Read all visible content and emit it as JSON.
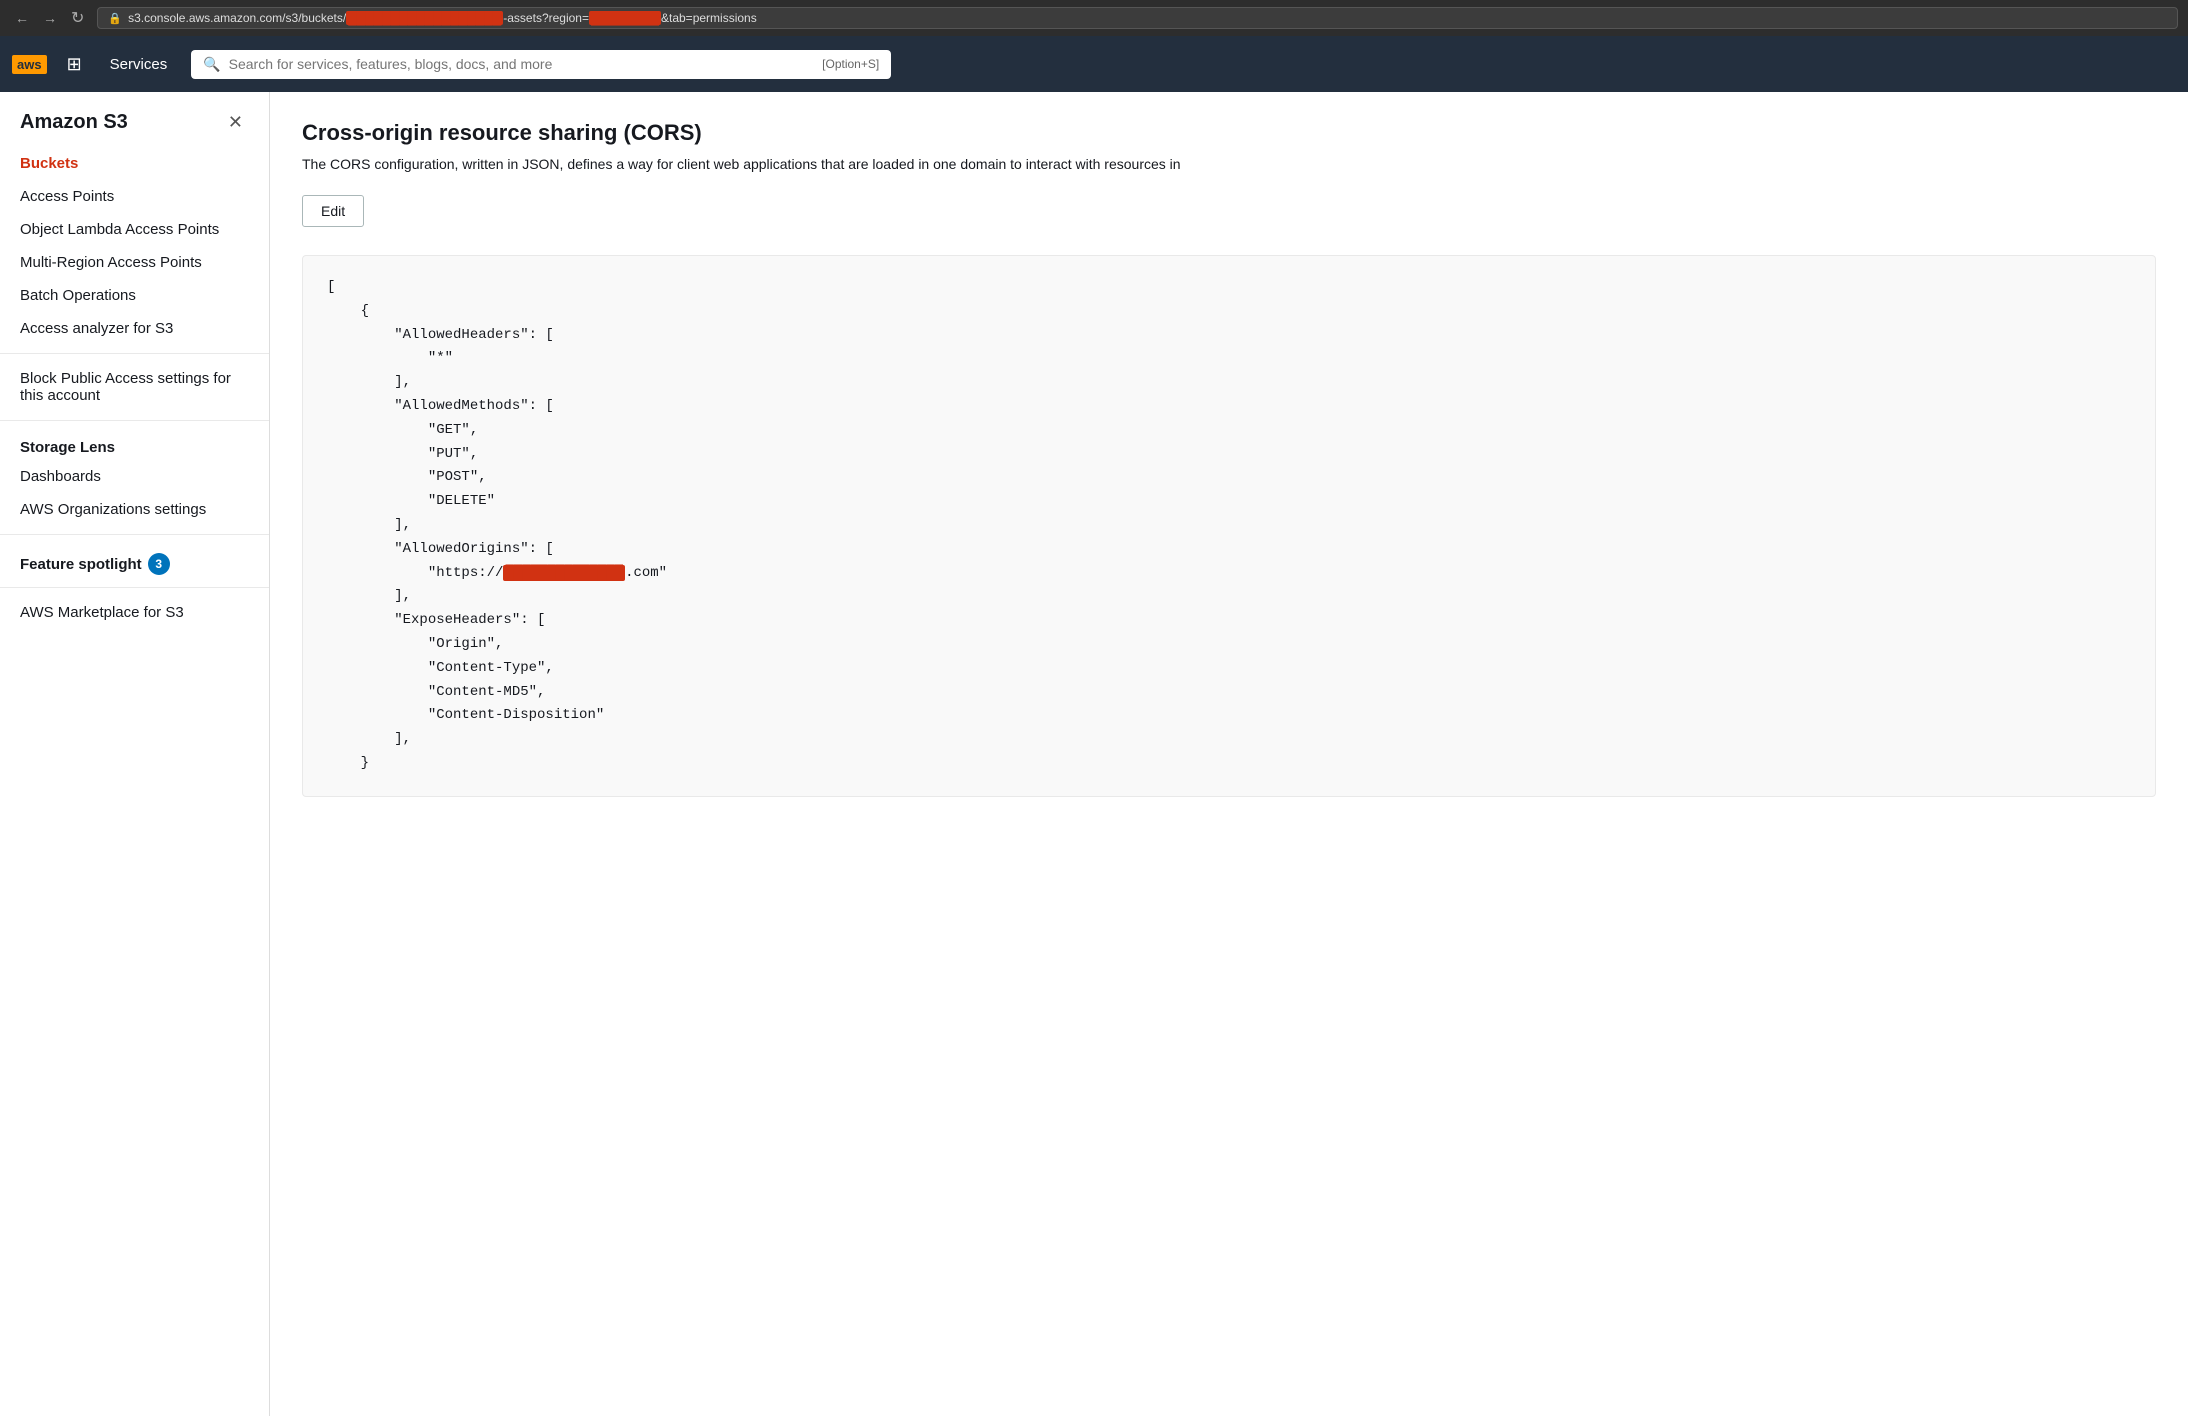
{
  "browser": {
    "address": "s3.console.aws.amazon.com/s3/buckets/",
    "address_suffix": "-assets?region=",
    "address_end": "&tab=permissions",
    "lock_icon": "🔒"
  },
  "aws_nav": {
    "logo_text": "aws",
    "services_label": "Services",
    "search_placeholder": "Search for services, features, blogs, docs, and more",
    "search_shortcut": "[Option+S]"
  },
  "sidebar": {
    "title": "Amazon S3",
    "close_icon": "✕",
    "items": [
      {
        "label": "Buckets",
        "active": true
      },
      {
        "label": "Access Points",
        "active": false
      },
      {
        "label": "Object Lambda Access Points",
        "active": false
      },
      {
        "label": "Multi-Region Access Points",
        "active": false
      },
      {
        "label": "Batch Operations",
        "active": false
      },
      {
        "label": "Access analyzer for S3",
        "active": false
      }
    ],
    "account_settings": [
      {
        "label": "Block Public Access settings for this account"
      }
    ],
    "storage_lens": {
      "header": "Storage Lens",
      "items": [
        {
          "label": "Dashboards"
        },
        {
          "label": "AWS Organizations settings"
        }
      ]
    },
    "feature_spotlight": {
      "label": "Feature spotlight",
      "badge": "3"
    },
    "marketplace": {
      "label": "AWS Marketplace for S3"
    }
  },
  "content": {
    "cors_title": "Cross-origin resource sharing (CORS)",
    "cors_description": "The CORS configuration, written in JSON, defines a way for client web applications that are loaded in one domain to interact with resources in",
    "edit_button": "Edit",
    "code": {
      "line1": "[",
      "line2": "    {",
      "line3": "        \"AllowedHeaders\": [",
      "line4": "            \"*\"",
      "line5": "        ],",
      "line6": "        \"AllowedMethods\": [",
      "line7": "            \"GET\",",
      "line8": "            \"PUT\",",
      "line9": "            \"POST\",",
      "line10": "            \"DELETE\"",
      "line11": "        ],",
      "line12": "        \"AllowedOrigins\": [",
      "line13_prefix": "            \"https://",
      "line13_suffix": ".com\"",
      "line14": "        ],",
      "line15": "        \"ExposeHeaders\": [",
      "line16": "            \"Origin\",",
      "line17": "            \"Content-Type\",",
      "line18": "            \"Content-MD5\",",
      "line19": "            \"Content-Disposition\"",
      "line20": "        ],",
      "line21": "    }"
    }
  }
}
